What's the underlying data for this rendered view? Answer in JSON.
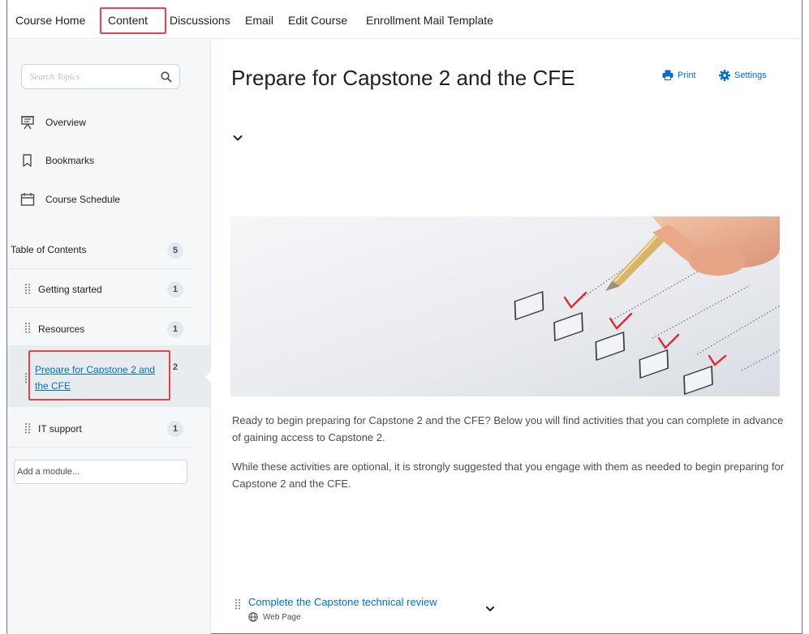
{
  "nav": {
    "items": [
      {
        "label": "Course Home"
      },
      {
        "label": "Content"
      },
      {
        "label": "Discussions"
      },
      {
        "label": "Email"
      },
      {
        "label": "Edit Course"
      },
      {
        "label": "Enrollment Mail Template"
      }
    ],
    "active": "Content"
  },
  "sidebar": {
    "search_placeholder": "Search Topics",
    "links": [
      {
        "label": "Overview",
        "icon": "presentation-icon"
      },
      {
        "label": "Bookmarks",
        "icon": "bookmark-icon"
      },
      {
        "label": "Course Schedule",
        "icon": "calendar-icon"
      }
    ],
    "toc": {
      "label": "Table of Contents",
      "count": "5"
    },
    "modules": [
      {
        "label": "Getting started",
        "count": "1"
      },
      {
        "label": "Resources",
        "count": "1"
      },
      {
        "label": "Prepare for Capstone 2 and the CFE",
        "count": "2",
        "active": true
      },
      {
        "label": "IT support",
        "count": "1"
      }
    ],
    "add_module_placeholder": "Add a module..."
  },
  "main": {
    "title": "Prepare for Capstone 2 and the CFE",
    "print_label": "Print",
    "settings_label": "Settings",
    "paragraphs": [
      "Ready to begin preparing for Capstone 2 and the CFE? Below you will find activities that you can complete in advance of gaining access to Capstone 2.",
      "While these activities are optional, it is strongly suggested that you engage with them as needed to begin preparing for Capstone 2 and the CFE."
    ],
    "topic": {
      "title": "Complete the Capstone technical review",
      "type": "Web Page"
    }
  },
  "colors": {
    "link": "#006fbf",
    "highlight_border": "#e8434b",
    "sidebar_bg": "#f6f7f8",
    "active_row_bg": "#e9ecef"
  }
}
